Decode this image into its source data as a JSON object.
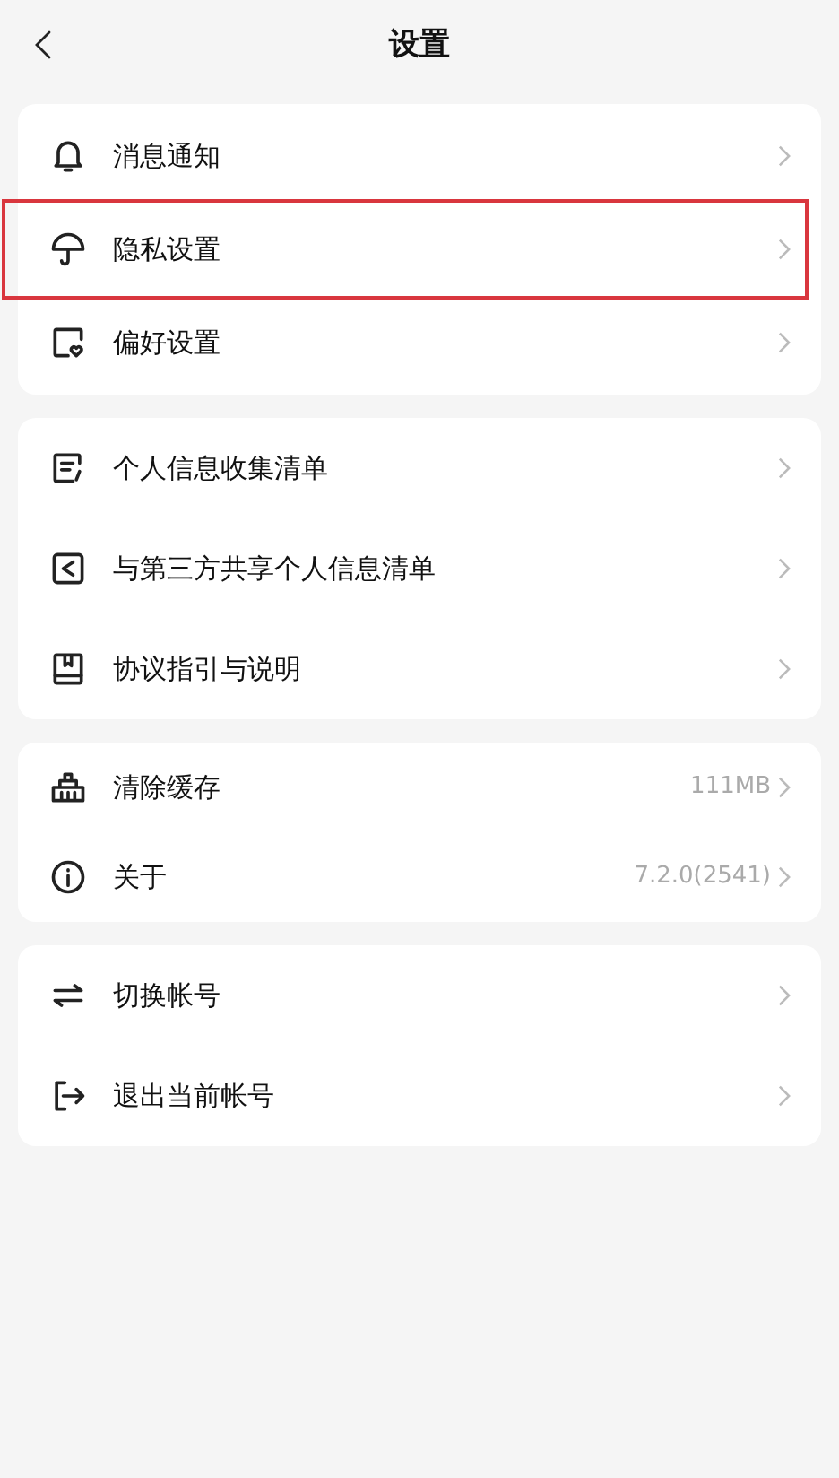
{
  "header": {
    "title": "设置"
  },
  "sections": [
    {
      "items": [
        {
          "label": "消息通知",
          "highlighted": false
        },
        {
          "label": "隐私设置",
          "highlighted": true
        },
        {
          "label": "偏好设置",
          "highlighted": false
        }
      ]
    },
    {
      "items": [
        {
          "label": "个人信息收集清单",
          "highlighted": false
        },
        {
          "label": "与第三方共享个人信息清单",
          "highlighted": false
        },
        {
          "label": "协议指引与说明",
          "highlighted": false
        }
      ]
    },
    {
      "items": [
        {
          "label": "清除缓存",
          "value": "111MB",
          "highlighted": false
        },
        {
          "label": "关于",
          "value": "7.2.0(2541)",
          "highlighted": false
        }
      ]
    },
    {
      "items": [
        {
          "label": "切换帐号",
          "highlighted": false
        },
        {
          "label": "退出当前帐号",
          "highlighted": false
        }
      ]
    }
  ]
}
